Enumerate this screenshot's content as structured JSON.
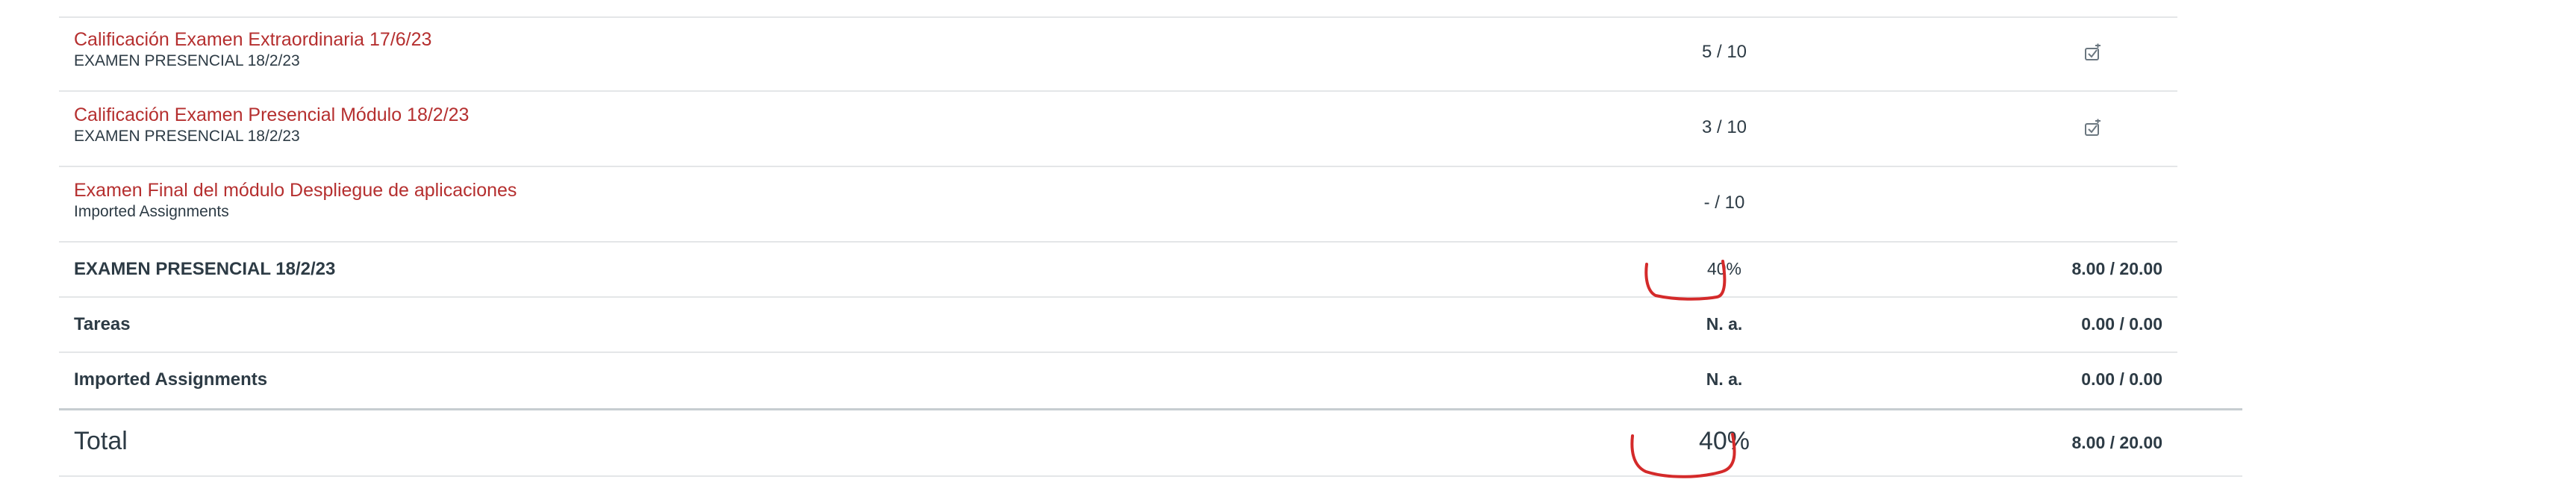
{
  "rows": [
    {
      "kind": "assignment",
      "title": "Calificación Examen Extraordinaria 17/6/23",
      "context": "EXAMEN PRESENCIAL 18/2/23",
      "score": "5 / 10",
      "icon": "submission-status-icon"
    },
    {
      "kind": "assignment",
      "title": "Calificación Examen Presencial Módulo 18/2/23",
      "context": "EXAMEN PRESENCIAL 18/2/23",
      "score": "3 / 10",
      "icon": "submission-status-icon"
    },
    {
      "kind": "assignment",
      "title": "Examen Final del módulo Despliegue de aplicaciones",
      "context": "Imported Assignments",
      "score": "- / 10"
    }
  ],
  "groups": [
    {
      "name": "EXAMEN PRESENCIAL 18/2/23",
      "score": "40%",
      "points": "8.00 / 20.00"
    },
    {
      "name": "Tareas",
      "score": "N. a.",
      "points": "0.00 / 0.00"
    },
    {
      "name": "Imported Assignments",
      "score": "N. a.",
      "points": "0.00 / 0.00"
    }
  ],
  "total": {
    "label": "Total",
    "score": "40%",
    "points": "8.00 / 20.00"
  },
  "colors": {
    "link": "#b52f2f",
    "text": "#2d3b45",
    "annotation": "#d42a2a",
    "divider": "#e4e6e8"
  }
}
